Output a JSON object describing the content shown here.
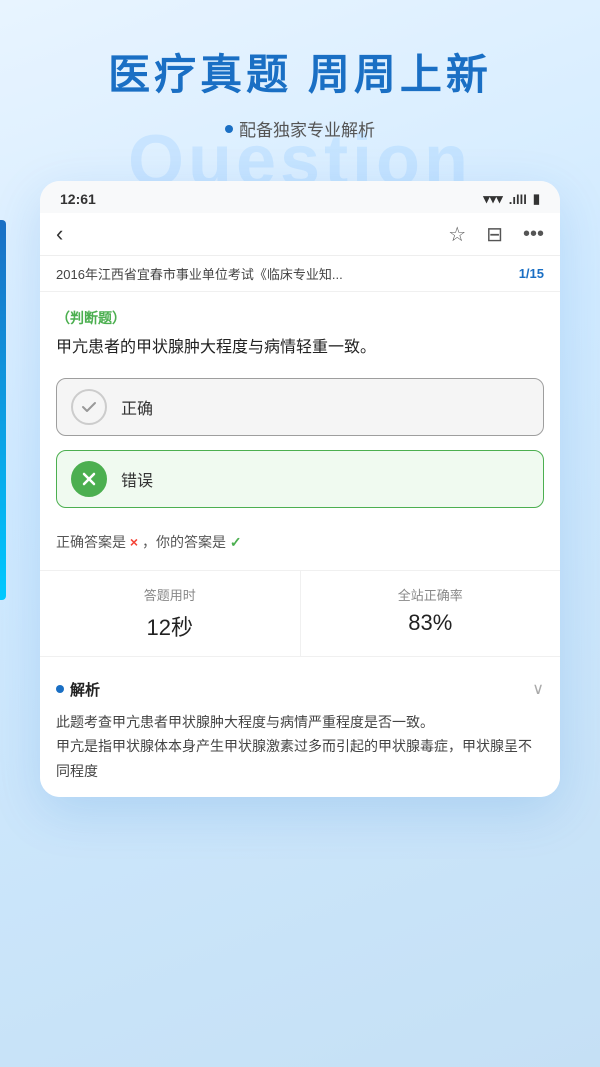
{
  "hero": {
    "title": "医疗真题  周周上新",
    "subtitle": "配备独家专业解析",
    "watermark": "Question"
  },
  "status_bar": {
    "time": "12:61",
    "wifi": "📶",
    "signal": "▐▐▐",
    "battery": "🔋"
  },
  "nav": {
    "back_icon": "‹",
    "star_icon": "☆",
    "list_icon": "⊞",
    "more_icon": "•••"
  },
  "breadcrumb": {
    "title": "2016年江西省宜春市事业单位考试《临床专业知...",
    "page": "1/15"
  },
  "question": {
    "type": "（判断题）",
    "text": "甲亢患者的甲状腺肿大程度与病情轻重一致。"
  },
  "options": [
    {
      "label": "正确",
      "state": "unchecked"
    },
    {
      "label": "错误",
      "state": "checked_wrong"
    }
  ],
  "result": {
    "text": "正确答案是 × ，你的答案是 ✓"
  },
  "stats": [
    {
      "label": "答题用时",
      "value": "12秒"
    },
    {
      "label": "全站正确率",
      "value": "83%"
    }
  ],
  "analysis": {
    "title": "解析",
    "text": "此题考查甲亢患者甲状腺肿大程度与病情严重程度是否一致。\n甲亢是指甲状腺体本身产生甲状腺激素过多而引起的甲状腺毒症，甲状腺呈不同程度"
  }
}
